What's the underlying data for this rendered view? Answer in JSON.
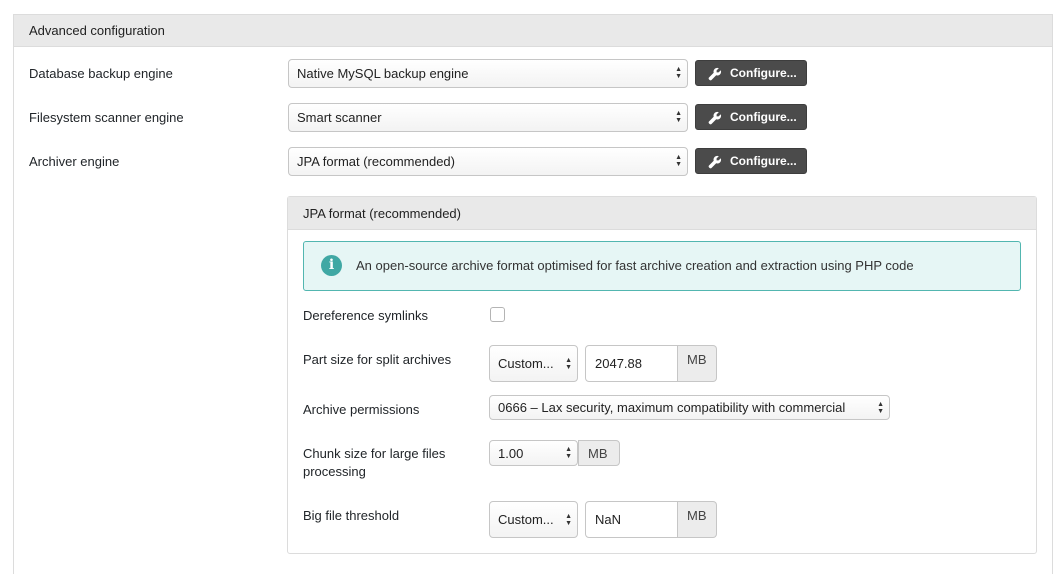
{
  "panel": {
    "title": "Advanced configuration"
  },
  "engines": [
    {
      "label": "Database backup engine",
      "value": "Native MySQL backup engine",
      "button": "Configure..."
    },
    {
      "label": "Filesystem scanner engine",
      "value": "Smart scanner",
      "button": "Configure..."
    },
    {
      "label": "Archiver engine",
      "value": "JPA format (recommended)",
      "button": "Configure..."
    }
  ],
  "archiver_panel": {
    "title": "JPA format (recommended)",
    "info": "An open-source archive format optimised for fast archive creation and extraction using PHP code",
    "dereference": {
      "label": "Dereference symlinks",
      "checked": false
    },
    "part_size": {
      "label": "Part size for split archives",
      "select": "Custom...",
      "value": "2047.88",
      "unit": "MB"
    },
    "permissions": {
      "label": "Archive permissions",
      "select": "0666 – Lax security, maximum compatibility with commercial"
    },
    "chunk_size": {
      "label_line1": "Chunk size for large files",
      "label_line2": "processing",
      "select": "1.00",
      "unit": "MB"
    },
    "big_file": {
      "label": "Big file threshold",
      "select": "Custom...",
      "value": "NaN",
      "unit": "MB"
    }
  },
  "colors": {
    "header_bg": "#e9e9e9",
    "button_dark": "#4b4b4b",
    "info_bg": "#e6f6f5",
    "info_border": "#52b6b0",
    "info_icon": "#40a8a4"
  }
}
